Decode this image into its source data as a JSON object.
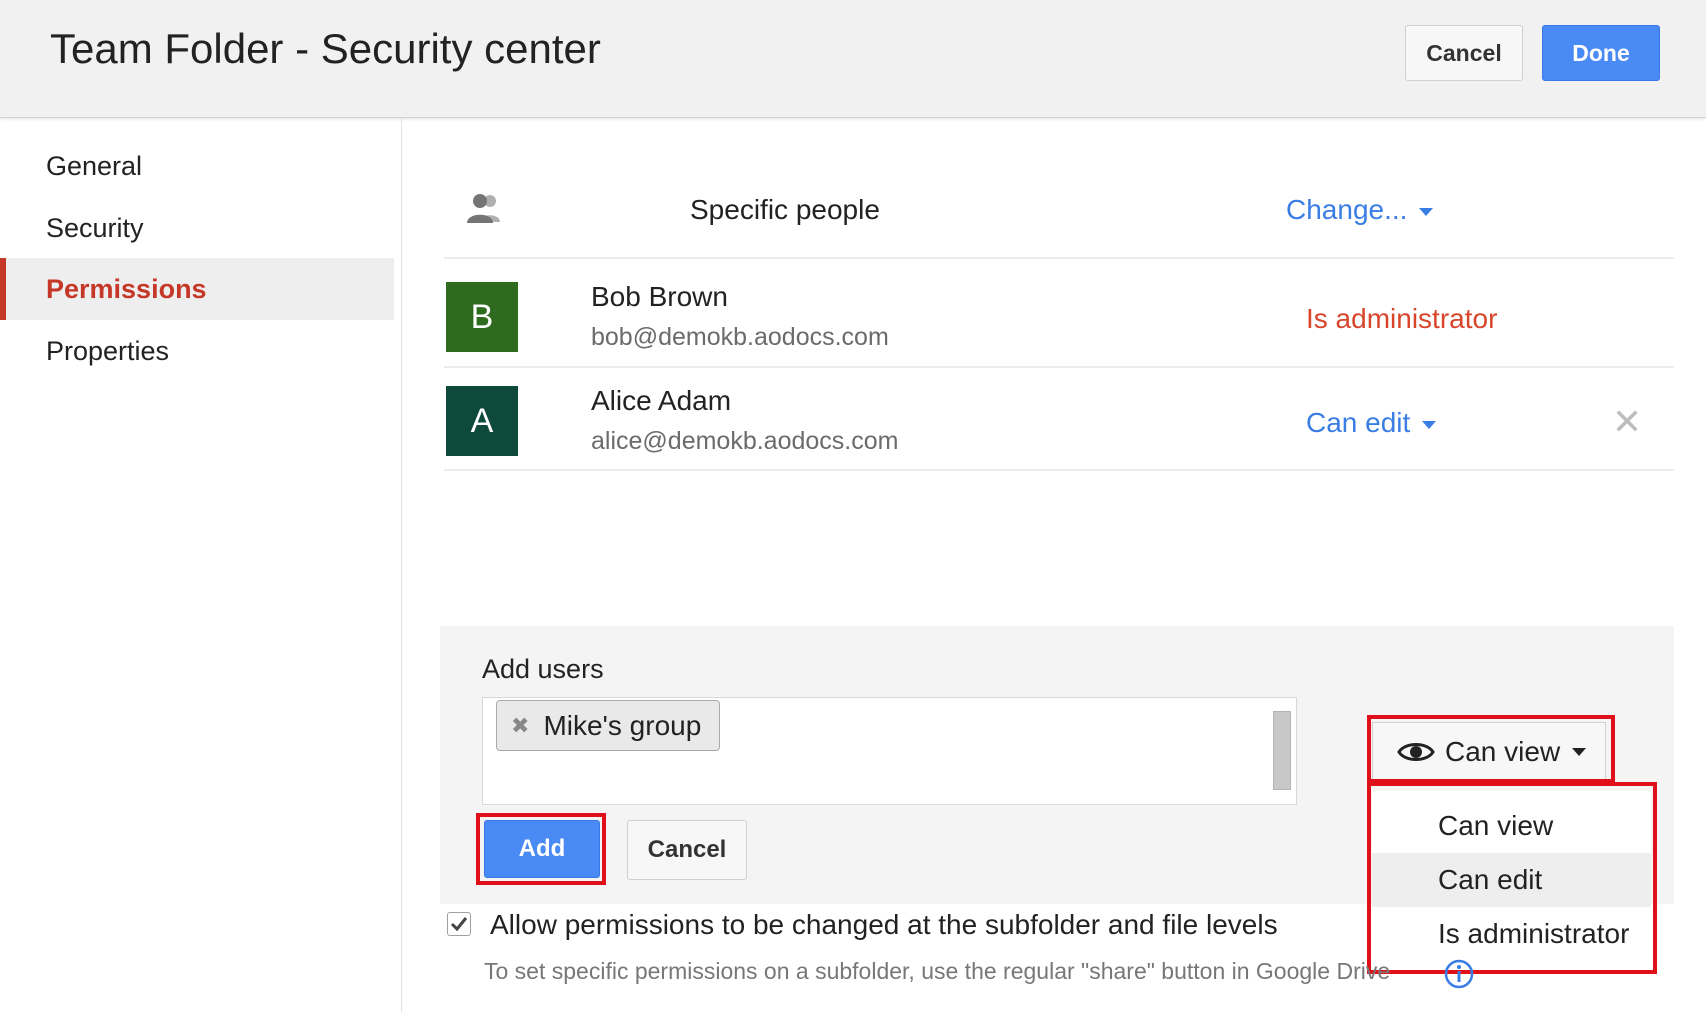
{
  "header": {
    "title": "Team Folder - Security center",
    "cancel_label": "Cancel",
    "done_label": "Done"
  },
  "sidebar": {
    "items": [
      {
        "label": "General"
      },
      {
        "label": "Security"
      },
      {
        "label": "Permissions",
        "active": true
      },
      {
        "label": "Properties"
      }
    ]
  },
  "sharing": {
    "scope_label": "Specific people",
    "change_label": "Change...",
    "users": [
      {
        "initial": "B",
        "name": "Bob Brown",
        "email": "bob@demokb.aodocs.com",
        "role": "Is administrator",
        "avatar_color": "#2e6b1f"
      },
      {
        "initial": "A",
        "name": "Alice Adam",
        "email": "alice@demokb.aodocs.com",
        "role": "Can edit",
        "avatar_color": "#0d4a3c"
      }
    ]
  },
  "add_users": {
    "label": "Add users",
    "chips": [
      "Mike's group"
    ],
    "add_label": "Add",
    "cancel_label": "Cancel",
    "permission": {
      "selected": "Can view",
      "options": [
        "Can view",
        "Can edit",
        "Is administrator"
      ],
      "hovered": "Can edit"
    }
  },
  "options": {
    "allow_subfolder_label": "Allow permissions to be changed at the subfolder and file levels",
    "allow_subfolder_checked": true,
    "hint": "To set specific permissions on a subfolder, use the regular \"share\" button in Google Drive"
  },
  "colors": {
    "accent_blue": "#4a8af4",
    "link_blue": "#3a7de4",
    "active_red": "#c53727",
    "admin_red": "#d8452b",
    "highlight_red": "#e0101b"
  }
}
